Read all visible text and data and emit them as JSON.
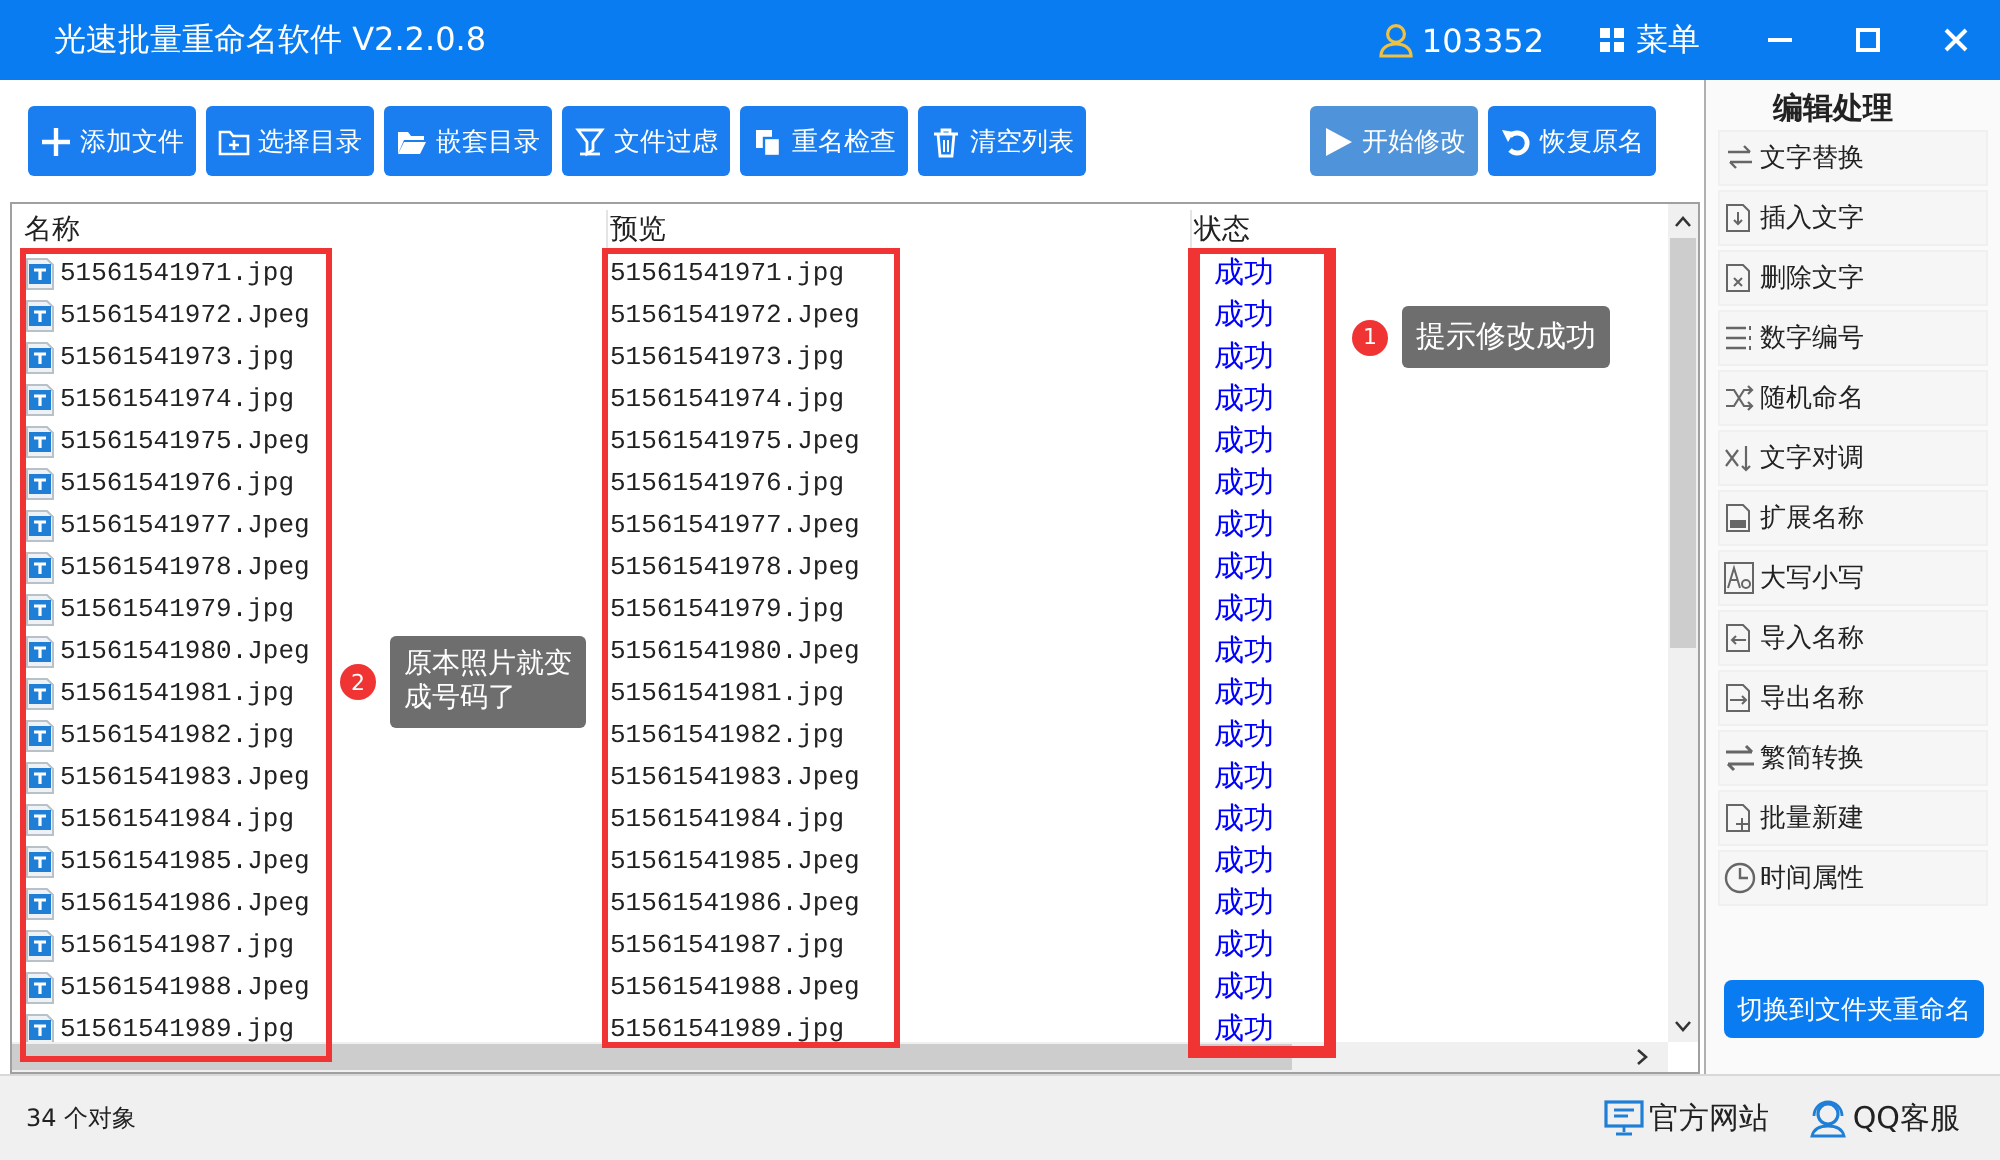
{
  "window": {
    "title": "光速批量重命名软件 V2.2.0.8",
    "user_id": "103352",
    "menu": "菜单"
  },
  "toolbar": [
    {
      "label": "添加文件",
      "kind": "normal"
    },
    {
      "label": "选择目录",
      "kind": "normal"
    },
    {
      "label": "嵌套目录",
      "kind": "normal"
    },
    {
      "label": "文件过虑",
      "kind": "normal"
    },
    {
      "label": "重名检查",
      "kind": "normal"
    },
    {
      "label": "清空列表",
      "kind": "normal"
    },
    {
      "label": "开始修改",
      "kind": "muted"
    },
    {
      "label": "恢复原名",
      "kind": "normal"
    }
  ],
  "table": {
    "columns": [
      "名称",
      "预览",
      "状态"
    ],
    "rows": [
      {
        "name": "51561541971.jpg",
        "preview": "51561541971.jpg",
        "status": "成功"
      },
      {
        "name": "51561541972.Jpeg",
        "preview": "51561541972.Jpeg",
        "status": "成功"
      },
      {
        "name": "51561541973.jpg",
        "preview": "51561541973.jpg",
        "status": "成功"
      },
      {
        "name": "51561541974.jpg",
        "preview": "51561541974.jpg",
        "status": "成功"
      },
      {
        "name": "51561541975.Jpeg",
        "preview": "51561541975.Jpeg",
        "status": "成功"
      },
      {
        "name": "51561541976.jpg",
        "preview": "51561541976.jpg",
        "status": "成功"
      },
      {
        "name": "51561541977.Jpeg",
        "preview": "51561541977.Jpeg",
        "status": "成功"
      },
      {
        "name": "51561541978.Jpeg",
        "preview": "51561541978.Jpeg",
        "status": "成功"
      },
      {
        "name": "51561541979.jpg",
        "preview": "51561541979.jpg",
        "status": "成功"
      },
      {
        "name": "51561541980.Jpeg",
        "preview": "51561541980.Jpeg",
        "status": "成功"
      },
      {
        "name": "51561541981.jpg",
        "preview": "51561541981.jpg",
        "status": "成功"
      },
      {
        "name": "51561541982.jpg",
        "preview": "51561541982.jpg",
        "status": "成功"
      },
      {
        "name": "51561541983.Jpeg",
        "preview": "51561541983.Jpeg",
        "status": "成功"
      },
      {
        "name": "51561541984.jpg",
        "preview": "51561541984.jpg",
        "status": "成功"
      },
      {
        "name": "51561541985.Jpeg",
        "preview": "51561541985.Jpeg",
        "status": "成功"
      },
      {
        "name": "51561541986.Jpeg",
        "preview": "51561541986.Jpeg",
        "status": "成功"
      },
      {
        "name": "51561541987.jpg",
        "preview": "51561541987.jpg",
        "status": "成功"
      },
      {
        "name": "51561541988.Jpeg",
        "preview": "51561541988.Jpeg",
        "status": "成功"
      },
      {
        "name": "51561541989.jpg",
        "preview": "51561541989.jpg",
        "status": "成功"
      }
    ]
  },
  "callouts": [
    {
      "number": "1",
      "text": "提示修改成功"
    },
    {
      "number": "2",
      "text": "原本照片就变成号码了"
    }
  ],
  "sidebar": {
    "title": "编辑处理",
    "items": [
      "文字替换",
      "插入文字",
      "删除文字",
      "数字编号",
      "随机命名",
      "文字对调",
      "扩展名称",
      "大写小写",
      "导入名称",
      "导出名称",
      "繁简转换",
      "批量新建",
      "时间属性"
    ],
    "switch_button": "切换到文件夹重命名"
  },
  "status_bar": {
    "count": "34 个对象",
    "links": [
      "官方网站",
      "QQ客服"
    ]
  }
}
